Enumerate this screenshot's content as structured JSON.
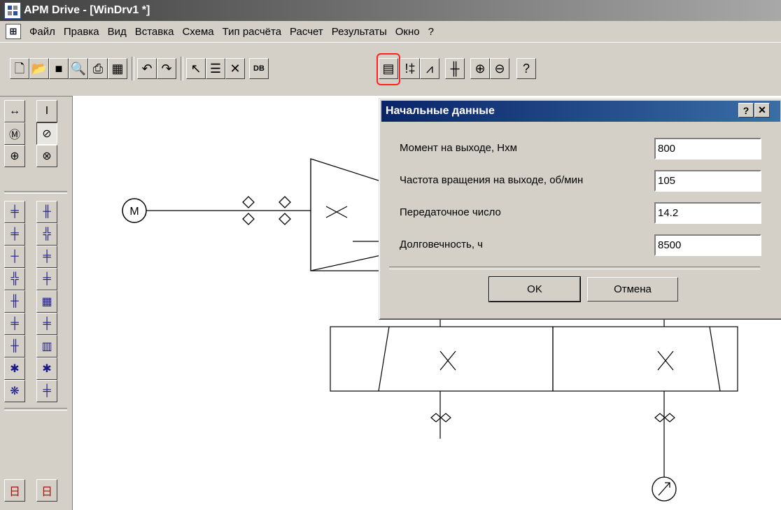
{
  "app": {
    "title": "APM Drive - [WinDrv1 *]",
    "icon": "app-grid-icon"
  },
  "menu": {
    "icon": "document-menu-icon",
    "items": [
      "Файл",
      "Правка",
      "Вид",
      "Вставка",
      "Схема",
      "Тип расчёта",
      "Расчет",
      "Результаты",
      "Окно",
      "?"
    ]
  },
  "toolbar": {
    "db_label": "DB",
    "highlight_color": "#ff2020",
    "icons": [
      "new-file-icon",
      "open-folder-icon",
      "save-icon",
      "print-preview-icon",
      "print-icon",
      "table-icon",
      "undo-icon",
      "redo-icon",
      "select-arrow-icon",
      "properties-icon",
      "delete-icon",
      "database-icon",
      "initial-data-icon",
      "check-icon",
      "chart-icon",
      "gear-train-icon",
      "zoom-in-icon",
      "zoom-out-icon",
      "help-icon"
    ]
  },
  "palette": {
    "icons": [
      "shaft-horizontal-icon",
      "shaft-vertical-icon",
      "motor-icon",
      "output-icon",
      "bearing-icon",
      "coupling-icon"
    ]
  },
  "schema": {
    "motor_label": "M"
  },
  "dialog": {
    "title": "Начальные данные",
    "help_label": "?",
    "close_label": "✕",
    "fields": [
      {
        "label": "Момент на выходе, Нхм",
        "value": "800"
      },
      {
        "label": "Частота вращения на выходе, об/мин",
        "value": "105"
      },
      {
        "label": "Передаточное число",
        "value": "14.2"
      },
      {
        "label": "Долговечность, ч",
        "value": "8500"
      }
    ],
    "ok_label": "OK",
    "cancel_label": "Отмена"
  }
}
